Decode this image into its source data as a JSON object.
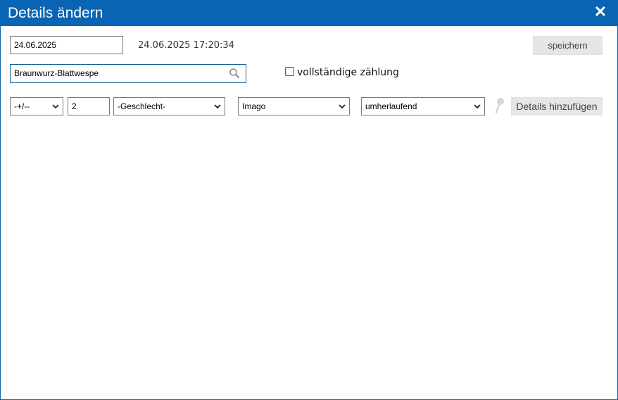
{
  "dialog": {
    "title": "Details ändern",
    "close_symbol": "✕"
  },
  "form": {
    "date_value": "24.06.2025",
    "timestamp": "24.06.2025 17:20:34",
    "save_label": "speichern",
    "species_value": "Braunwurz-Blattwespe",
    "complete_count_label": "vollständige zählung",
    "complete_count_checked": false,
    "precision_select": "-+/--",
    "count_value": "2",
    "sex_select": "-Geschlecht-",
    "stage_select": "Imago",
    "activity_select": "umherlaufend",
    "add_details_label": "Details hinzufügen"
  },
  "icons": {
    "search": "search-icon",
    "close": "close-icon",
    "pin": "pin-icon",
    "dropdown": "chevron-down-icon"
  },
  "colors": {
    "titlebar": "#0a64b4",
    "button_bg": "#e6e6e6"
  }
}
